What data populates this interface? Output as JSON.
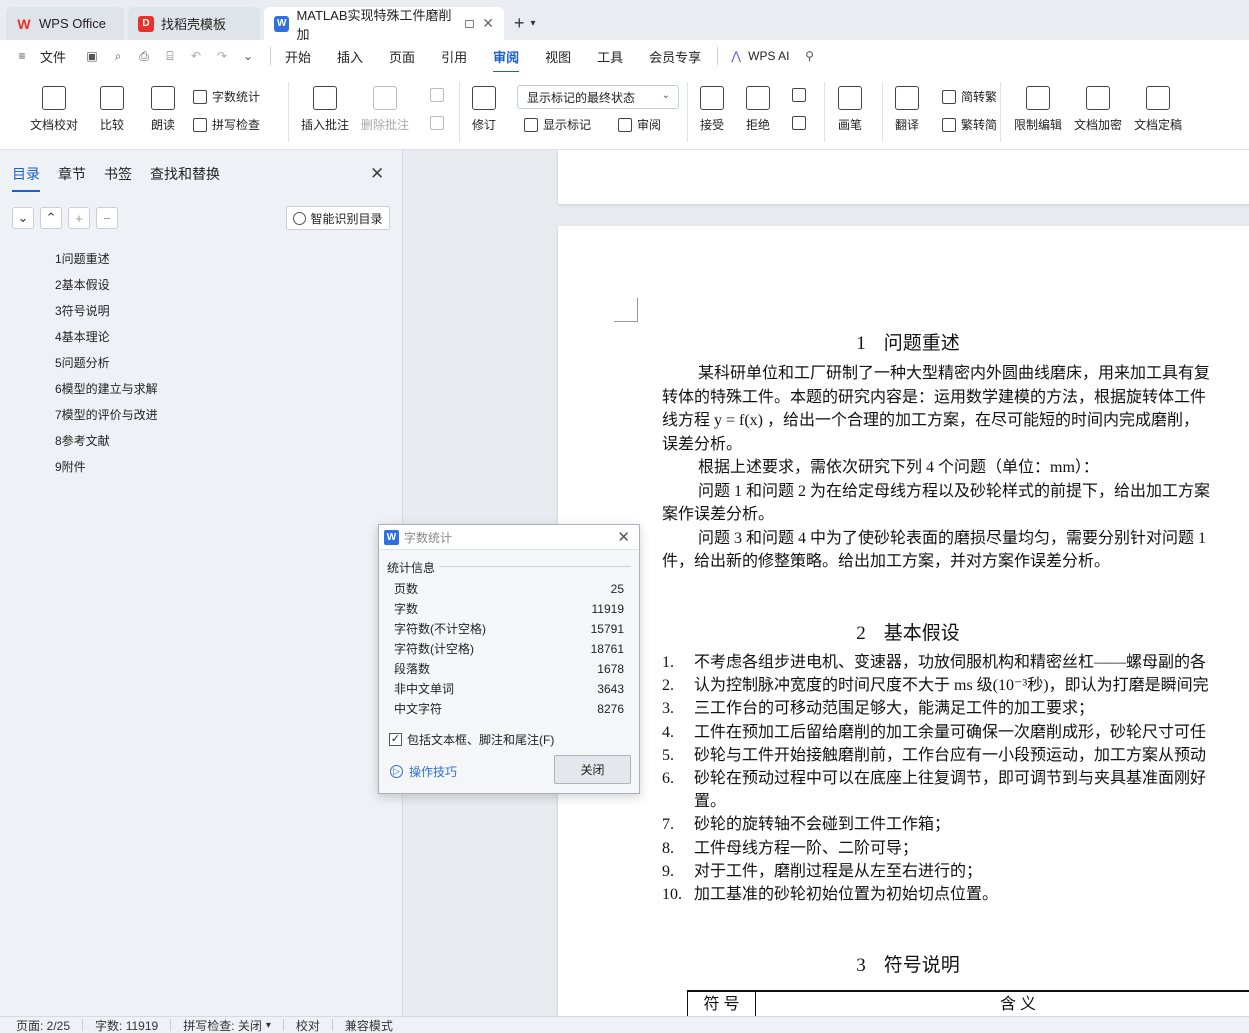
{
  "tabs": [
    {
      "label": "WPS Office",
      "color": "#e8312a"
    },
    {
      "label": "找稻壳模板",
      "color": "#e8312a"
    },
    {
      "label": "MATLAB实现特殊工件磨削加",
      "color": "#2f6fe0"
    }
  ],
  "menu": {
    "file": "文件",
    "items": [
      "开始",
      "插入",
      "页面",
      "引用",
      "审阅",
      "视图",
      "工具",
      "会员专享"
    ],
    "active": "审阅",
    "ai": "WPS AI"
  },
  "ribbon": {
    "doc_check": "文档校对",
    "compare": "比较",
    "read_aloud": "朗读",
    "word_count": "字数统计",
    "spell_check": "拼写检查",
    "insert_comment": "插入批注",
    "delete_comment": "删除批注",
    "track_changes": "修订",
    "markup_state": "显示标记的最终状态",
    "show_markup": "显示标记",
    "review": "审阅",
    "accept": "接受",
    "reject": "拒绝",
    "pen": "画笔",
    "translate": "翻译",
    "to_traditional": "简转繁",
    "to_simplified": "繁转简",
    "restrict_edit": "限制编辑",
    "encrypt": "文档加密",
    "finalize": "文档定稿"
  },
  "left_panel": {
    "tabs": [
      "目录",
      "章节",
      "书签",
      "查找和替换"
    ],
    "smart_toc": "智能识别目录",
    "toc": [
      "1问题重述",
      "2基本假设",
      "3符号说明",
      "4基本理论",
      "5问题分析",
      "6模型的建立与求解",
      "7模型的评价与改进",
      "8参考文献",
      "9附件"
    ]
  },
  "document": {
    "h1_num": "1",
    "h1_title": "问题重述",
    "p1_l1": "某科研单位和工厂研制了一种大型精密内外圆曲线磨床，用来加工具有复",
    "p1_l2": "转体的特殊工件。本题的研究内容是：运用数学建模的方法，根据旋转体工件",
    "p1_l3": "线方程 y = f(x) ，给出一个合理的加工方案，在尽可能短的时间内完成磨削，",
    "p1_l4": "误差分析。",
    "p2": "根据上述要求，需依次研究下列 4 个问题（单位：mm）：",
    "p3_l1": "问题 1 和问题 2 为在给定母线方程以及砂轮样式的前提下，给出加工方案",
    "p3_l2": "案作误差分析。",
    "p4_l1": "问题 3 和问题 4 中为了使砂轮表面的磨损尽量均匀，需要分别针对问题 1",
    "p4_l2": "件，给出新的修整策略。给出加工方案，并对方案作误差分析。",
    "h2_num": "2",
    "h2_title": "基本假设",
    "assumptions": [
      {
        "n": "1.",
        "t": "不考虑各组步进电机、变速器，功放伺服机构和精密丝杠——螺母副的各"
      },
      {
        "n": "2.",
        "t": "认为控制脉冲宽度的时间尺度不大于 ms 级(10⁻³秒)，即认为打磨是瞬间完"
      },
      {
        "n": "3.",
        "t": "三工作台的可移动范围足够大，能满足工件的加工要求；"
      },
      {
        "n": "4.",
        "t": "工件在预加工后留给磨削的加工余量可确保一次磨削成形，砂轮尺寸可任"
      },
      {
        "n": "5.",
        "t": "砂轮与工件开始接触磨削前，工作台应有一小段预运动，加工方案从预动"
      },
      {
        "n": "6.",
        "t": "砂轮在预动过程中可以在底座上往复调节，即可调节到与夹具基准面刚好"
      },
      {
        "n": "",
        "t": "置。"
      },
      {
        "n": "7.",
        "t": "砂轮的旋转轴不会碰到工件工作箱；"
      },
      {
        "n": "8.",
        "t": "工件母线方程一阶、二阶可导；"
      },
      {
        "n": "9.",
        "t": "对于工件，磨削过程是从左至右进行的；"
      },
      {
        "n": "10.",
        "t": "加工基准的砂轮初始位置为初始切点位置。"
      }
    ],
    "h3_num": "3",
    "h3_title": "符号说明",
    "table_col1": "符 号",
    "table_col2": "含 义"
  },
  "dialog": {
    "title": "字数统计",
    "group": "统计信息",
    "stats": [
      {
        "label": "页数",
        "value": "25"
      },
      {
        "label": "字数",
        "value": "11919"
      },
      {
        "label": "字符数(不计空格)",
        "value": "15791"
      },
      {
        "label": "字符数(计空格)",
        "value": "18761"
      },
      {
        "label": "段落数",
        "value": "1678"
      },
      {
        "label": "非中文单词",
        "value": "3643"
      },
      {
        "label": "中文字符",
        "value": "8276"
      }
    ],
    "include_label": "包括文本框、脚注和尾注(F)",
    "tips": "操作技巧",
    "close": "关闭"
  },
  "status": {
    "page": "页面: 2/25",
    "words": "字数: 11919",
    "spell": "拼写检查: 关闭",
    "proof": "校对",
    "compat": "兼容模式"
  }
}
